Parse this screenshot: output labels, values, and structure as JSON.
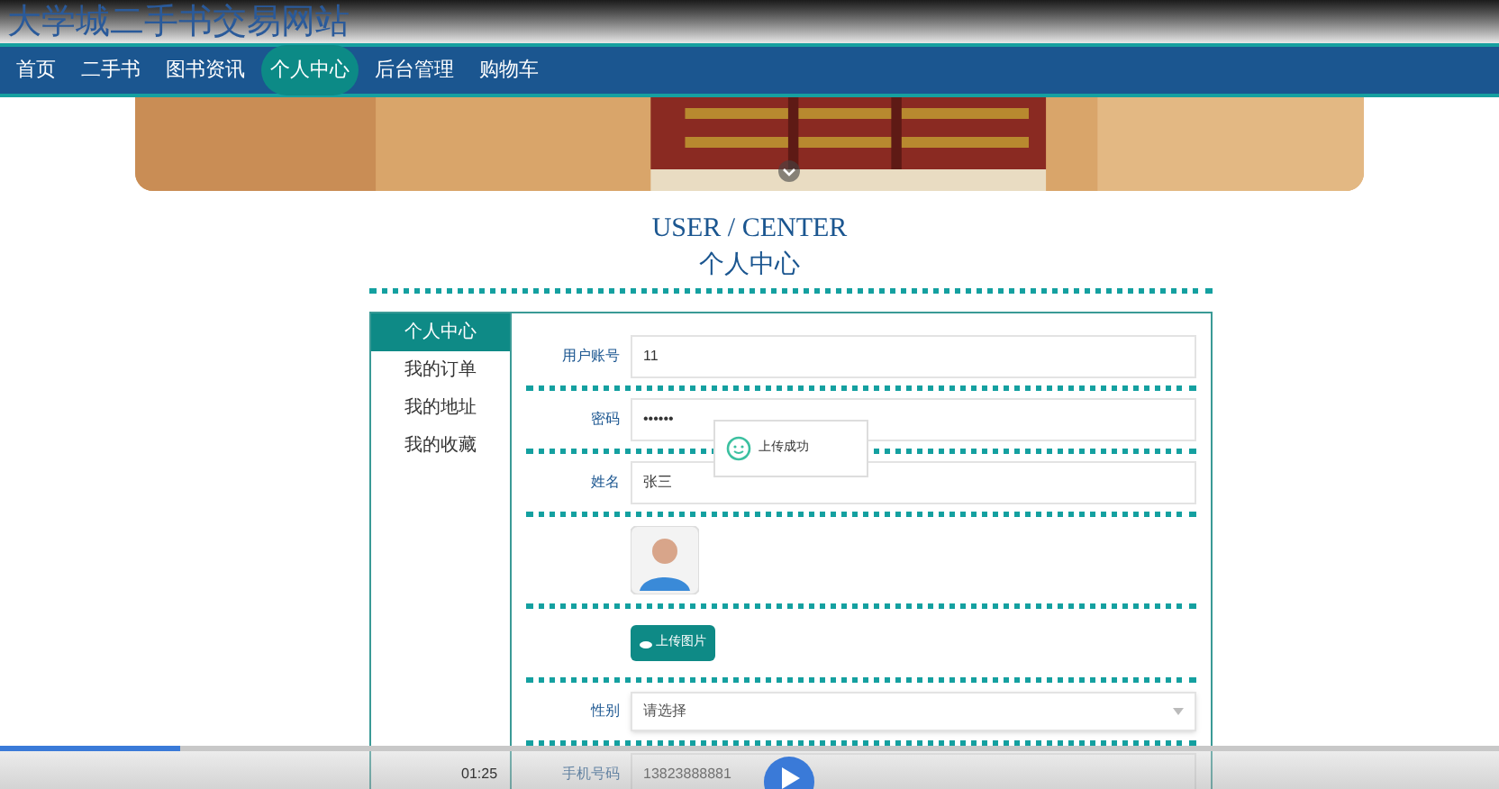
{
  "site_title": "大学城二手书交易网站",
  "nav": [
    {
      "label": "首页",
      "selected": false
    },
    {
      "label": "二手书",
      "selected": false
    },
    {
      "label": "图书资讯",
      "selected": false
    },
    {
      "label": "个人中心",
      "selected": true
    },
    {
      "label": "后台管理",
      "selected": false
    },
    {
      "label": "购物车",
      "selected": false
    }
  ],
  "heading_en": "USER / CENTER",
  "heading_cn": "个人中心",
  "sidebar": [
    {
      "label": "个人中心",
      "selected": true
    },
    {
      "label": "我的订单",
      "selected": false
    },
    {
      "label": "我的地址",
      "selected": false
    },
    {
      "label": "我的收藏",
      "selected": false
    }
  ],
  "form": [
    {
      "kind": "text",
      "label": "用户账号",
      "value": "11"
    },
    {
      "kind": "text",
      "label": "密码",
      "value": "••••••"
    },
    {
      "kind": "text",
      "label": "姓名",
      "value": "张三"
    },
    {
      "kind": "avatar"
    },
    {
      "kind": "upload",
      "label": "上传图片"
    },
    {
      "kind": "select",
      "label": "性别",
      "placeholder": "请选择"
    },
    {
      "kind": "text",
      "label": "手机号码",
      "value": "13823888881"
    }
  ],
  "toast": "上传成功",
  "player": {
    "time": "01:25",
    "level": 0.12
  }
}
